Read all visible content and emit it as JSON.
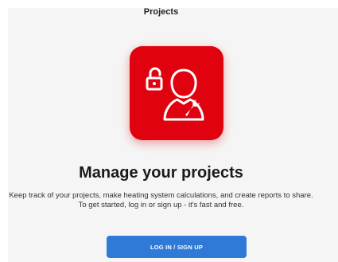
{
  "header": {
    "title": "Projects"
  },
  "hero": {
    "icon": "user-with-wrench-and-padlock-icon",
    "tile_color": "#e0030f"
  },
  "content": {
    "headline": "Manage your projects",
    "description_line1": "Keep track of your projects, make heating system calculations, and create reports to share.",
    "description_line2": "To get started, log in or sign up - it's fast and free."
  },
  "cta": {
    "label": "LOG IN / SIGN UP",
    "color": "#2f7ad6"
  }
}
